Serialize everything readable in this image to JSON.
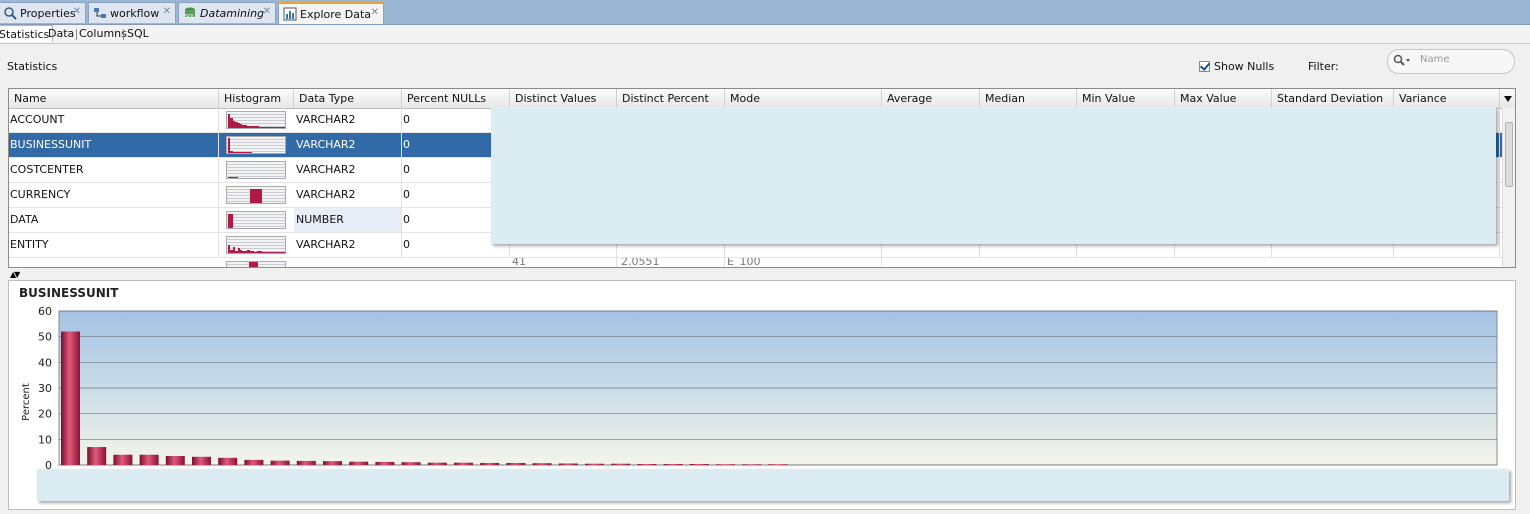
{
  "tabs": [
    {
      "label": "Properties",
      "icon": "properties-icon",
      "italic": false,
      "active": false
    },
    {
      "label": "workflow",
      "icon": "workflow-icon",
      "italic": false,
      "active": false
    },
    {
      "label": "Datamining",
      "icon": "sql-database-icon",
      "italic": true,
      "active": false
    },
    {
      "label": "Explore Data",
      "icon": "explore-data-icon",
      "italic": false,
      "active": true
    }
  ],
  "subtabs": [
    "Statistics",
    "Data",
    "Columns",
    "SQL"
  ],
  "statistics_label": "Statistics",
  "show_nulls": {
    "label": "Show Nulls",
    "checked": true
  },
  "filter": {
    "label": "Filter:",
    "placeholder": "Name"
  },
  "table": {
    "columns": [
      "Name",
      "Histogram",
      "Data Type",
      "Percent NULLs",
      "Distinct Values",
      "Distinct Percent",
      "Mode",
      "Average",
      "Median",
      "Min Value",
      "Max Value",
      "Standard Deviation",
      "Variance"
    ],
    "rows": [
      {
        "name": "ACCOUNT",
        "type": "VARCHAR2",
        "nulls": "0",
        "hist": [
          0.9,
          0.6,
          0.45,
          0.35,
          0.3,
          0.25,
          0.2,
          0.18,
          0.15,
          0.13,
          0.12,
          0.1,
          0.1,
          0.09,
          0.08,
          0.08,
          0.07,
          0.07,
          0.06,
          0.06,
          0.06,
          0.05,
          0.05,
          0.05
        ]
      },
      {
        "name": "BUSINESSUNIT",
        "type": "VARCHAR2",
        "nulls": "0",
        "hist": [
          0.95,
          0.15,
          0.08,
          0.08,
          0.07,
          0.06,
          0.05,
          0.04,
          0.04,
          0.04,
          0.03,
          0.03,
          0.03,
          0.03,
          0.02,
          0.02,
          0.02,
          0.02,
          0.02,
          0.01,
          0.01,
          0.01,
          0.01,
          0.01
        ]
      },
      {
        "name": "COSTCENTER",
        "type": "VARCHAR2",
        "nulls": "0",
        "hist": [
          0.08,
          0.05,
          0.04,
          0.04,
          0.03,
          0.03,
          0.03,
          0.03,
          0.03,
          0.02,
          0.02,
          0.02,
          0.02,
          0.02,
          0.02,
          0.02,
          0.02,
          0.02,
          0.02,
          0.02,
          0.02,
          0.02,
          0.02,
          0.02
        ]
      },
      {
        "name": "CURRENCY",
        "type": "VARCHAR2",
        "nulls": "0",
        "hist": [
          0,
          0,
          0,
          0,
          0,
          0,
          0,
          0,
          0,
          0.9,
          0.9,
          0.9,
          0.9,
          0.9,
          0,
          0,
          0,
          0,
          0,
          0,
          0,
          0,
          0,
          0
        ]
      },
      {
        "name": "DATA",
        "type": "NUMBER",
        "nulls": "0",
        "hist": [
          0.9,
          0.9,
          0,
          0,
          0,
          0,
          0,
          0,
          0,
          0,
          0,
          0,
          0,
          0,
          0,
          0,
          0,
          0,
          0,
          0,
          0,
          0,
          0,
          0
        ]
      },
      {
        "name": "ENTITY",
        "type": "VARCHAR2",
        "nulls": "0",
        "hist": [
          0.5,
          0.2,
          0.35,
          0.15,
          0.3,
          0.2,
          0.15,
          0.1,
          0.2,
          0.1,
          0.15,
          0.08,
          0.12,
          0.1,
          0.08,
          0.06,
          0.08,
          0.06,
          0.05,
          0.05,
          0.05,
          0.04,
          0.04,
          0.04
        ]
      }
    ],
    "partial_row_values": [
      "41",
      "2.0551",
      "E_100"
    ],
    "selected_row": "BUSINESSUNIT"
  },
  "chart_data": {
    "type": "bar",
    "title": "BUSINESSUNIT",
    "ylabel": "Percent",
    "xlabel": "",
    "ylim": [
      0,
      60
    ],
    "yticks": [
      0,
      10,
      20,
      30,
      40,
      50,
      60
    ],
    "values": [
      52,
      7,
      4,
      4,
      3.5,
      3.2,
      2.8,
      2,
      1.7,
      1.6,
      1.5,
      1.3,
      1.2,
      1.1,
      0.9,
      0.9,
      0.8,
      0.8,
      0.7,
      0.6,
      0.5,
      0.5,
      0.4,
      0.4,
      0.4,
      0.3,
      0.3,
      0.3
    ],
    "grid": true
  },
  "colors": {
    "bar": "#b01a46",
    "selection": "#316aa6",
    "tab_strip": "#9bb6d3",
    "overlay": "#dbedf2"
  }
}
